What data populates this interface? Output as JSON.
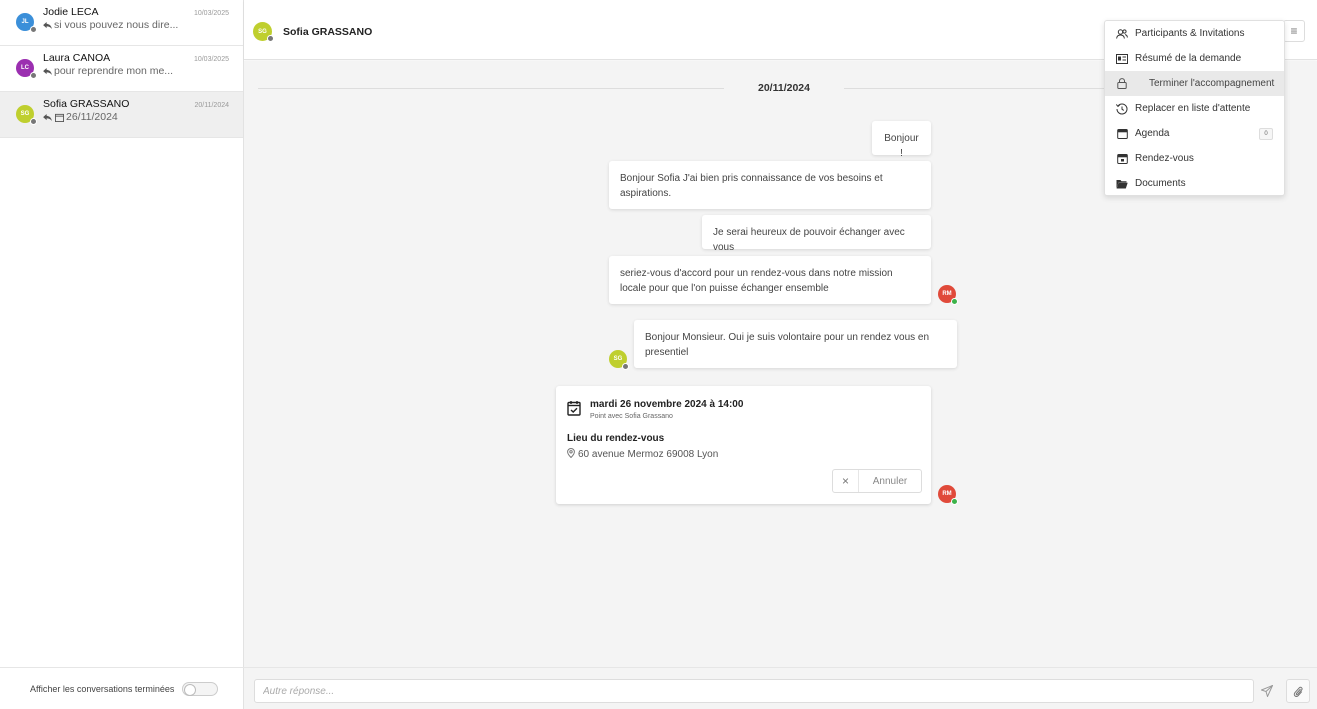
{
  "sidebar": {
    "conversations": [
      {
        "initials": "JL",
        "name": "Jodie LECA",
        "preview": "si vous pouvez nous dire...",
        "date": "10/03/2025",
        "color": "#3b8fd9"
      },
      {
        "initials": "LC",
        "name": "Laura CANOA",
        "preview": "pour reprendre mon me...",
        "date": "10/03/2025",
        "color": "#9b2fb0"
      },
      {
        "initials": "SG",
        "name": "Sofia GRASSANO",
        "preview": "26/11/2024",
        "date": "20/11/2024",
        "color": "#bfcf2e"
      }
    ],
    "show_finished_label": "Afficher les conversations terminées"
  },
  "header": {
    "initials": "SG",
    "title": "Sofia GRASSANO",
    "menu_icon": "hamburger-icon"
  },
  "chat": {
    "date_separator": "20/11/2024",
    "messages": [
      {
        "text": "Bonjour !"
      },
      {
        "text": "Bonjour Sofia J'ai bien pris connaissance de vos besoins et aspirations."
      },
      {
        "text": "Je serai heureux de pouvoir échanger avec vous"
      },
      {
        "text": "seriez-vous d'accord pour un rendez-vous dans notre mission locale pour que l'on puisse échanger ensemble"
      },
      {
        "text": "Bonjour Monsieur. Oui je suis volontaire pour un rendez vous en presentiel"
      }
    ],
    "agent_initials": "RM",
    "user_initials": "SG",
    "agent_color": "#e04a3a",
    "user_color": "#bfcf2e",
    "online_color": "#3cb34a",
    "offline_color": "#777777",
    "appointment": {
      "when": "mardi 26 novembre 2024 à 14:00",
      "subtitle": "Point avec Sofia Grassano",
      "location_title": "Lieu du rendez-vous",
      "address": "60 avenue Mermoz 69008 Lyon",
      "cancel_label": "Annuler"
    }
  },
  "menu": {
    "items": [
      {
        "label": "Participants & Invitations",
        "icon": "users-icon"
      },
      {
        "label": "Résumé de la demande",
        "icon": "summary-icon"
      },
      {
        "label": "Terminer l'accompagnement",
        "icon": "lock-icon"
      },
      {
        "label": "Replacer en liste d'attente",
        "icon": "history-icon"
      },
      {
        "label": "Agenda",
        "icon": "calendar-icon",
        "badge": "0"
      },
      {
        "label": "Rendez-vous",
        "icon": "calendar-check-icon"
      },
      {
        "label": "Documents",
        "icon": "folder-icon"
      }
    ]
  },
  "footer": {
    "reply_placeholder": "Autre réponse..."
  }
}
